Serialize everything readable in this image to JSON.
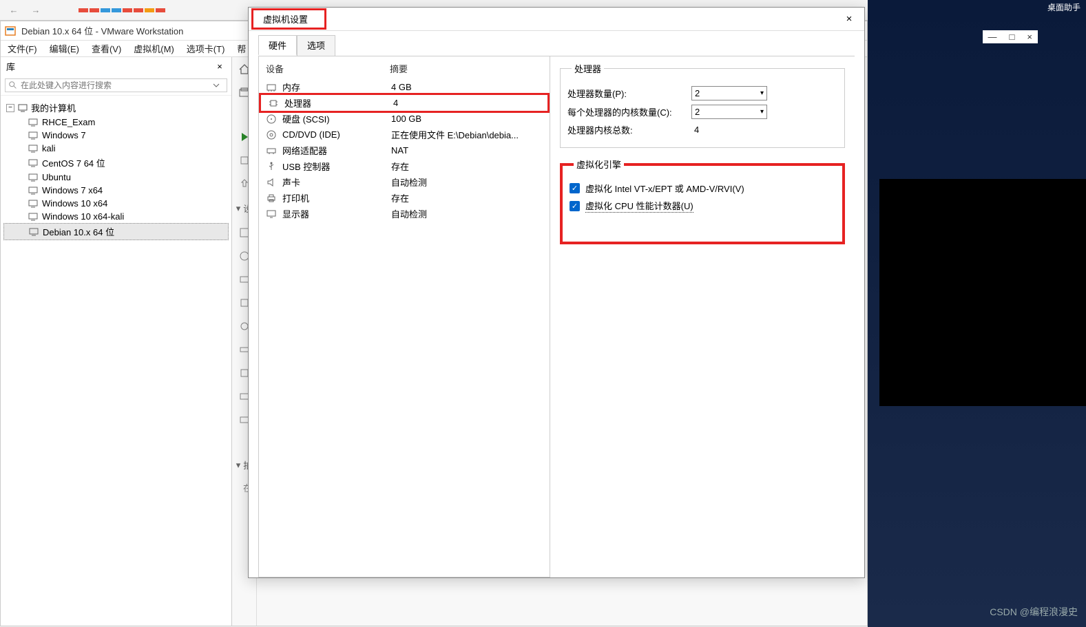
{
  "browser": {
    "back": "←",
    "fwd": "→"
  },
  "vmware": {
    "title": "Debian 10.x 64 位 - VMware Workstation",
    "menu": {
      "file": "文件(F)",
      "edit": "编辑(E)",
      "view": "查看(V)",
      "vm": "虚拟机(M)",
      "tabs": "选项卡(T)",
      "help": "帮"
    }
  },
  "sidebar": {
    "header": "库",
    "search_placeholder": "在此处键入内容进行搜索",
    "root": "我的计算机",
    "items": [
      "RHCE_Exam",
      "Windows 7",
      "kali",
      "CentOS 7 64 位",
      "Ubuntu",
      "Windows 7 x64",
      "Windows 10 x64",
      "Windows 10 x64-kali",
      "Debian 10.x 64 位"
    ],
    "selected_index": 8
  },
  "toolbar_sections": {
    "s1": "设",
    "s2": "拍",
    "s3": "在"
  },
  "dialog": {
    "title": "虚拟机设置",
    "close": "×",
    "tabs": {
      "hardware": "硬件",
      "options": "选项"
    },
    "device_header": {
      "device": "设备",
      "summary": "摘要"
    },
    "devices": [
      {
        "name": "内存",
        "summary": "4 GB",
        "icon": "memory"
      },
      {
        "name": "处理器",
        "summary": "4",
        "icon": "cpu",
        "hl": true
      },
      {
        "name": "硬盘 (SCSI)",
        "summary": "100 GB",
        "icon": "hdd"
      },
      {
        "name": "CD/DVD (IDE)",
        "summary": "正在使用文件 E:\\Debian\\debia...",
        "icon": "cd"
      },
      {
        "name": "网络适配器",
        "summary": "NAT",
        "icon": "net"
      },
      {
        "name": "USB 控制器",
        "summary": "存在",
        "icon": "usb"
      },
      {
        "name": "声卡",
        "summary": "自动检测",
        "icon": "sound"
      },
      {
        "name": "打印机",
        "summary": "存在",
        "icon": "printer"
      },
      {
        "name": "显示器",
        "summary": "自动检测",
        "icon": "display"
      }
    ],
    "processors": {
      "legend": "处理器",
      "num_label": "处理器数量(P):",
      "num_value": "2",
      "cores_label": "每个处理器的内核数量(C):",
      "cores_value": "2",
      "total_label": "处理器内核总数:",
      "total_value": "4"
    },
    "virt": {
      "legend": "虚拟化引擎",
      "vt_label": "虚拟化 Intel VT-x/EPT 或 AMD-V/RVI(V)",
      "perf_label": "虚拟化 CPU 性能计数器(U)"
    }
  },
  "desktop": {
    "assistant": "桌面助手",
    "min": "—",
    "max": "□",
    "close": "×"
  },
  "watermark": "CSDN @编程浪漫史"
}
